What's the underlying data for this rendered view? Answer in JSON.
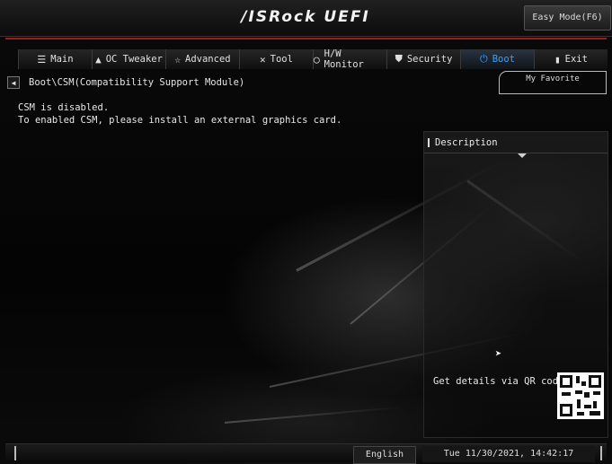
{
  "header": {
    "brand": "/ISRock UEFI",
    "easy_mode": "Easy Mode(F6)"
  },
  "tabs": [
    {
      "label": "Main",
      "icon": "list-icon",
      "glyph": "☰"
    },
    {
      "label": "OC Tweaker",
      "icon": "rocket-icon",
      "glyph": "▲"
    },
    {
      "label": "Advanced",
      "icon": "star-icon",
      "glyph": "☆"
    },
    {
      "label": "Tool",
      "icon": "tools-icon",
      "glyph": "✕"
    },
    {
      "label": "H/W Monitor",
      "icon": "monitor-icon",
      "glyph": "◯"
    },
    {
      "label": "Security",
      "icon": "shield-icon",
      "glyph": "⛊"
    },
    {
      "label": "Boot",
      "icon": "power-icon",
      "glyph": "⏻"
    },
    {
      "label": "Exit",
      "icon": "exit-icon",
      "glyph": "▮"
    }
  ],
  "active_tab": "Boot",
  "breadcrumb": "Boot\\CSM(Compatibility Support Module)",
  "my_favorite": "My Favorite",
  "messages": {
    "line1": "CSM is disabled.",
    "line2": "To enabled CSM, please install an external graphics card."
  },
  "description": {
    "title": "Description",
    "qr_text": "Get details via QR code"
  },
  "footer": {
    "language": "English",
    "datetime": "Tue 11/30/2021, 14:42:17"
  },
  "colors": {
    "accent_red": "#9c1b1b",
    "active_tab_blue": "#3aa0ff"
  }
}
